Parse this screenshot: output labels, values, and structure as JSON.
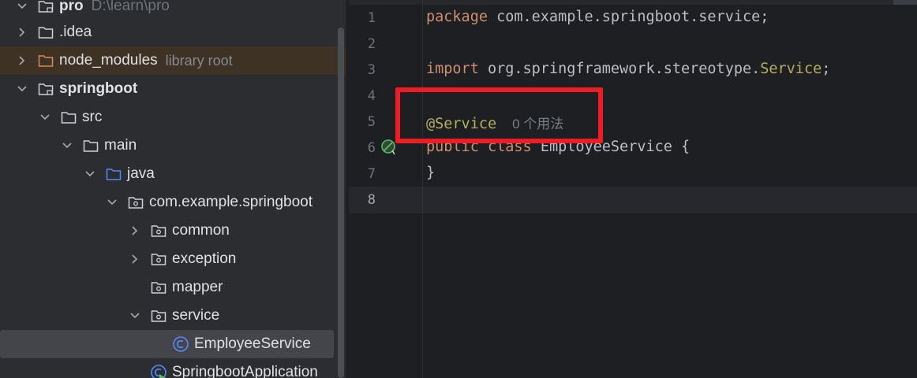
{
  "project": {
    "root": {
      "name": "pro",
      "path": "D:\\learn\\pro"
    },
    "items": [
      {
        "label": "pro",
        "secondary": "D:\\learn\\pro",
        "level": 0,
        "kind": "module",
        "expanded": true
      },
      {
        "label": ".idea",
        "level": 1,
        "kind": "folder",
        "expanded": false
      },
      {
        "label": "node_modules",
        "secondary": "library root",
        "level": 1,
        "kind": "folder-excluded",
        "expanded": false
      },
      {
        "label": "springboot",
        "level": 1,
        "kind": "module",
        "expanded": true
      },
      {
        "label": "src",
        "level": 2,
        "kind": "folder",
        "expanded": true
      },
      {
        "label": "main",
        "level": 3,
        "kind": "folder",
        "expanded": true
      },
      {
        "label": "java",
        "level": 4,
        "kind": "source-root",
        "expanded": true
      },
      {
        "label": "com.example.springboot",
        "level": 5,
        "kind": "package",
        "expanded": true
      },
      {
        "label": "common",
        "level": 6,
        "kind": "package",
        "expanded": false
      },
      {
        "label": "exception",
        "level": 6,
        "kind": "package",
        "expanded": false
      },
      {
        "label": "mapper",
        "level": 6,
        "kind": "package",
        "expanded": null
      },
      {
        "label": "service",
        "level": 6,
        "kind": "package",
        "expanded": true
      },
      {
        "label": "EmployeeService",
        "level": 7,
        "kind": "class",
        "selected": true
      },
      {
        "label": "SpringbootApplication",
        "level": 6,
        "kind": "spring-class"
      }
    ]
  },
  "editor": {
    "line_numbers": [
      "1",
      "2",
      "3",
      "4",
      "5",
      "6",
      "7",
      "8"
    ],
    "current_line": "8",
    "code": {
      "l1_kw": "package",
      "l1_rest": " com.example.springboot.service;",
      "l3_kw": "import",
      "l3_rest": " org.springframework.stereotype.",
      "l3_cls": "Service",
      "l3_end": ";",
      "l5_ann": "@Service",
      "l5_usage": "0 个用法",
      "l6_kw1": "public",
      "l6_kw2": "class",
      "l6_cls": "EmployeeService",
      "l6_brace": "{",
      "l7": "}"
    }
  },
  "colors": {
    "tree_bg": "#2b2d30",
    "editor_bg": "#1e1f22",
    "keyword": "#cf8e6d",
    "annotation": "#b3ae60",
    "highlight_box": "#ee1c24",
    "excluded_row": "#3d3223"
  }
}
